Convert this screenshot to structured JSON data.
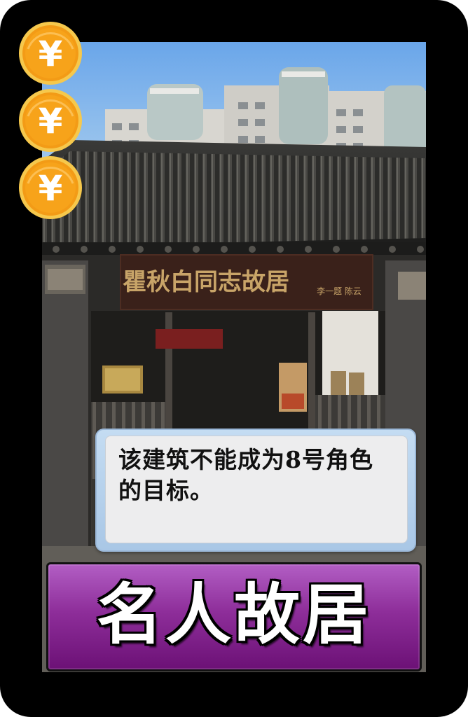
{
  "card": {
    "name": "名人故居",
    "description": "该建筑不能成为8号角色的目标。",
    "cost_coins": 3,
    "coin_symbol": "¥",
    "photo": {
      "plaque_text": "瞿秋白同志故居",
      "plaque_signature": "李一题 陈云"
    }
  },
  "colors": {
    "border": "#000000",
    "sky": "#6fa9e8",
    "coin": "#f7a318",
    "name_bar": "#8e2e9a",
    "text_panel": "#ededee"
  },
  "icons": {
    "coin": "yen-coin-icon"
  }
}
